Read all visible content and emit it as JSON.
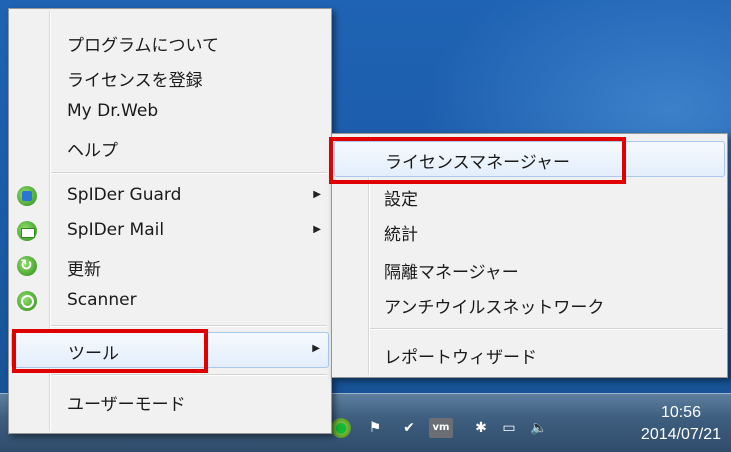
{
  "main_menu": {
    "items": [
      {
        "label": "プログラムについて"
      },
      {
        "label": "ライセンスを登録"
      },
      {
        "label": "My Dr.Web"
      },
      {
        "label": "ヘルプ"
      },
      {
        "label": "SpIDer Guard"
      },
      {
        "label": "SpIDer Mail"
      },
      {
        "label": "更新"
      },
      {
        "label": "Scanner"
      },
      {
        "label": "ツール"
      },
      {
        "label": "ユーザーモード"
      }
    ]
  },
  "sub_menu": {
    "items": [
      {
        "label": "ライセンスマネージャー"
      },
      {
        "label": "設定"
      },
      {
        "label": "統計"
      },
      {
        "label": "隔離マネージャー"
      },
      {
        "label": "アンチウイルスネットワーク"
      },
      {
        "label": "レポートウィザード"
      }
    ]
  },
  "taskbar": {
    "time": "10:56",
    "date": "2014/07/21",
    "vm_icon_text": "vm"
  },
  "colors": {
    "highlight_box": "#e00000",
    "menu_bg": "#f1f1f1",
    "desktop": "#1f63b4"
  }
}
